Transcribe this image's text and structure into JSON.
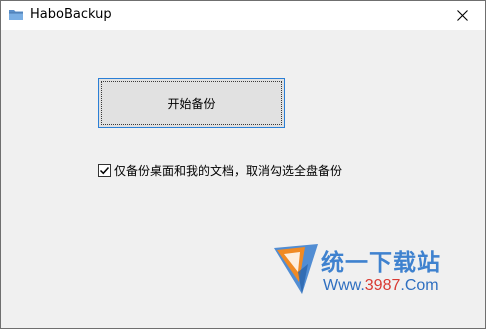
{
  "window": {
    "title": "HaboBackup",
    "app_icon": "folder-icon",
    "close_icon": "close-icon"
  },
  "main": {
    "start_button_label": "开始备份",
    "option": {
      "checked": true,
      "label": "仅备份桌面和我的文档，取消勾选全盘备份"
    }
  },
  "watermark": {
    "site_name": "统一下载站",
    "url_prefix": "Www.",
    "url_number": "3987",
    "url_suffix": ".Com",
    "colors": {
      "blue": "#3f82cf",
      "red": "#d93a32"
    }
  },
  "colors": {
    "window_bg": "#f0f0f0",
    "titlebar_bg": "#ffffff",
    "button_bg": "#e1e1e1",
    "button_focus_border": "#2b7fd6"
  }
}
